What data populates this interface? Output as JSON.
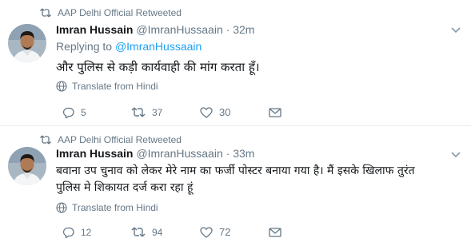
{
  "tweets": [
    {
      "retweeted_by": "AAP Delhi Official Retweeted",
      "name": "Imran Hussain",
      "handle": "@ImranHussaain",
      "dot": "·",
      "time": "32m",
      "replying_label": "Replying to",
      "replying_to": "@ImranHussaain",
      "text": "और पुलिस से कड़ी कार्यवाही की मांग करता हूँ।",
      "translate": "Translate from Hindi",
      "replies": "5",
      "retweets": "37",
      "likes": "30"
    },
    {
      "retweeted_by": "AAP Delhi Official Retweeted",
      "name": "Imran Hussain",
      "handle": "@ImranHussaain",
      "dot": "·",
      "time": "33m",
      "text_line1": "बवाना उप चुनाव को लेकर मेरे नाम का फर्जी पोस्टर बनाया गया है। मैं इसके खिलाफ तुरंत",
      "text_line2": "पुलिस मे शिकायत दर्ज करा रहा हूं",
      "translate": "Translate from Hindi",
      "replies": "12",
      "retweets": "94",
      "likes": "72"
    }
  ],
  "colors": {
    "accent": "#1da1f2",
    "muted": "#657786",
    "text": "#14171a",
    "divider": "#e6ecf0"
  },
  "icons": [
    "retweet-icon",
    "chevron-down-icon",
    "globe-icon",
    "reply-icon",
    "heart-icon",
    "direct-message-icon"
  ]
}
